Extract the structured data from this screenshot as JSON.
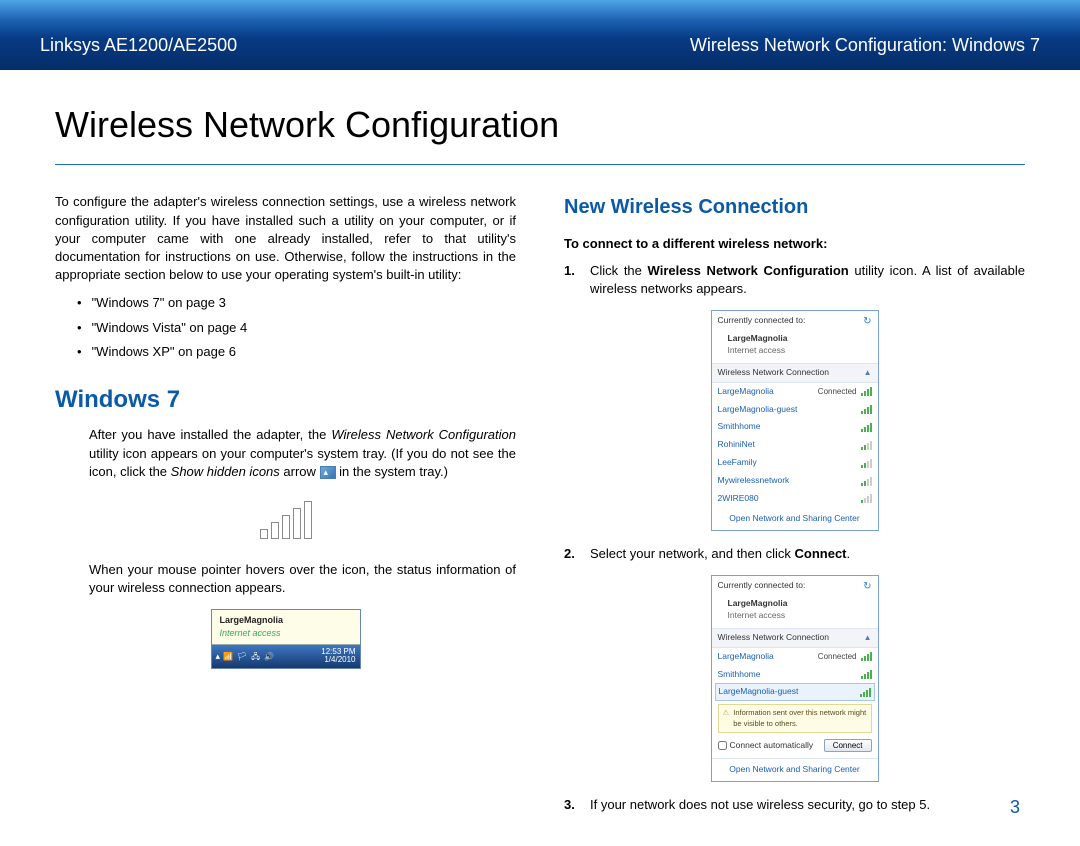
{
  "header": {
    "left": "Linksys AE1200/AE2500",
    "right": "Wireless Network Configuration: Windows 7"
  },
  "title": "Wireless Network Configuration",
  "intro": "To configure the adapter's wireless connection settings, use a wireless network configuration utility. If you have installed such a utility on your computer, or if your computer came with one already installed, refer to that utility's documentation for instructions on use. Otherwise, follow the instructions in the appropriate section below to use your operating system's built-in utility:",
  "refs": [
    "\"Windows 7\" on page 3",
    "\"Windows Vista\" on page 4",
    "\"Windows XP\" on page 6"
  ],
  "win7": {
    "heading": "Windows 7",
    "p1_a": "After you have installed the adapter, the ",
    "p1_em": "Wireless Network Configuration",
    "p1_b": " utility icon appears on your computer's system tray. (If you do not see the icon, click the ",
    "p1_em2": "Show hidden icons",
    "p1_c": " arrow ",
    "p1_d": " in the system tray.)",
    "p2": "When your mouse pointer hovers over the icon, the status information of your wireless connection appears."
  },
  "tray": {
    "name": "LargeMagnolia",
    "status": "Internet access",
    "time": "12:53 PM",
    "date": "1/4/2010"
  },
  "new_conn": {
    "heading": "New Wireless Connection",
    "lead": "To connect to a different wireless network:",
    "step1_a": "Click the ",
    "step1_b": "Wireless Network Configuration",
    "step1_c": " utility icon. A list of available wireless networks appears.",
    "step2_a": "Select your network, and then click ",
    "step2_b": "Connect",
    "step2_c": ".",
    "step3": "If your network does not use wireless security, go to step 5."
  },
  "panel": {
    "currently": "Currently connected to:",
    "conn_name": "LargeMagnolia",
    "conn_sub": "Internet access",
    "section": "Wireless Network Connection",
    "connected_lbl": "Connected",
    "nets": [
      "LargeMagnolia",
      "LargeMagnolia-guest",
      "Smithhome",
      "RohiniNet",
      "LeeFamily",
      "Mywirelessnetwork",
      "2WIRE080"
    ],
    "footer": "Open Network and Sharing Center"
  },
  "panel2": {
    "nets": [
      "LargeMagnolia",
      "Smithhome",
      "LargeMagnolia-guest"
    ],
    "warn": "Information sent over this network might be visible to others.",
    "auto": "Connect automatically",
    "btn": "Connect"
  },
  "page_number": "3"
}
